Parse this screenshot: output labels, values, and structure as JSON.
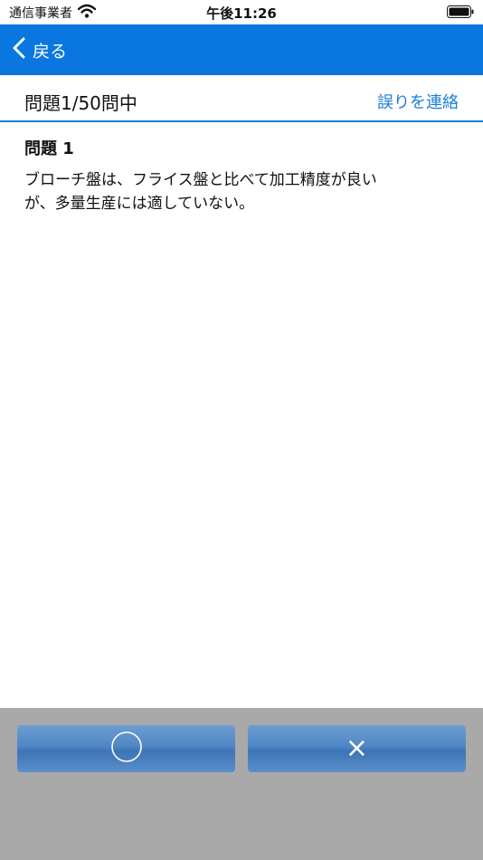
{
  "status": {
    "carrier": "通信事業者",
    "time": "午後11:26"
  },
  "nav": {
    "back_label": "戻る"
  },
  "info": {
    "counter": "問題1/50問中",
    "report": "誤りを連絡"
  },
  "question": {
    "title": "問題 1",
    "line1": "ブローチ盤は、フライス盤と比べて加工精度が良い",
    "line2": "が、多量生産には適していない。"
  },
  "answers": {
    "true_mark": "○",
    "false_mark": "×"
  },
  "colors": {
    "nav": "#0a76e0",
    "accent": "#1a7ed8",
    "panel": "#a9a9a9",
    "button": "#4f86c4"
  }
}
